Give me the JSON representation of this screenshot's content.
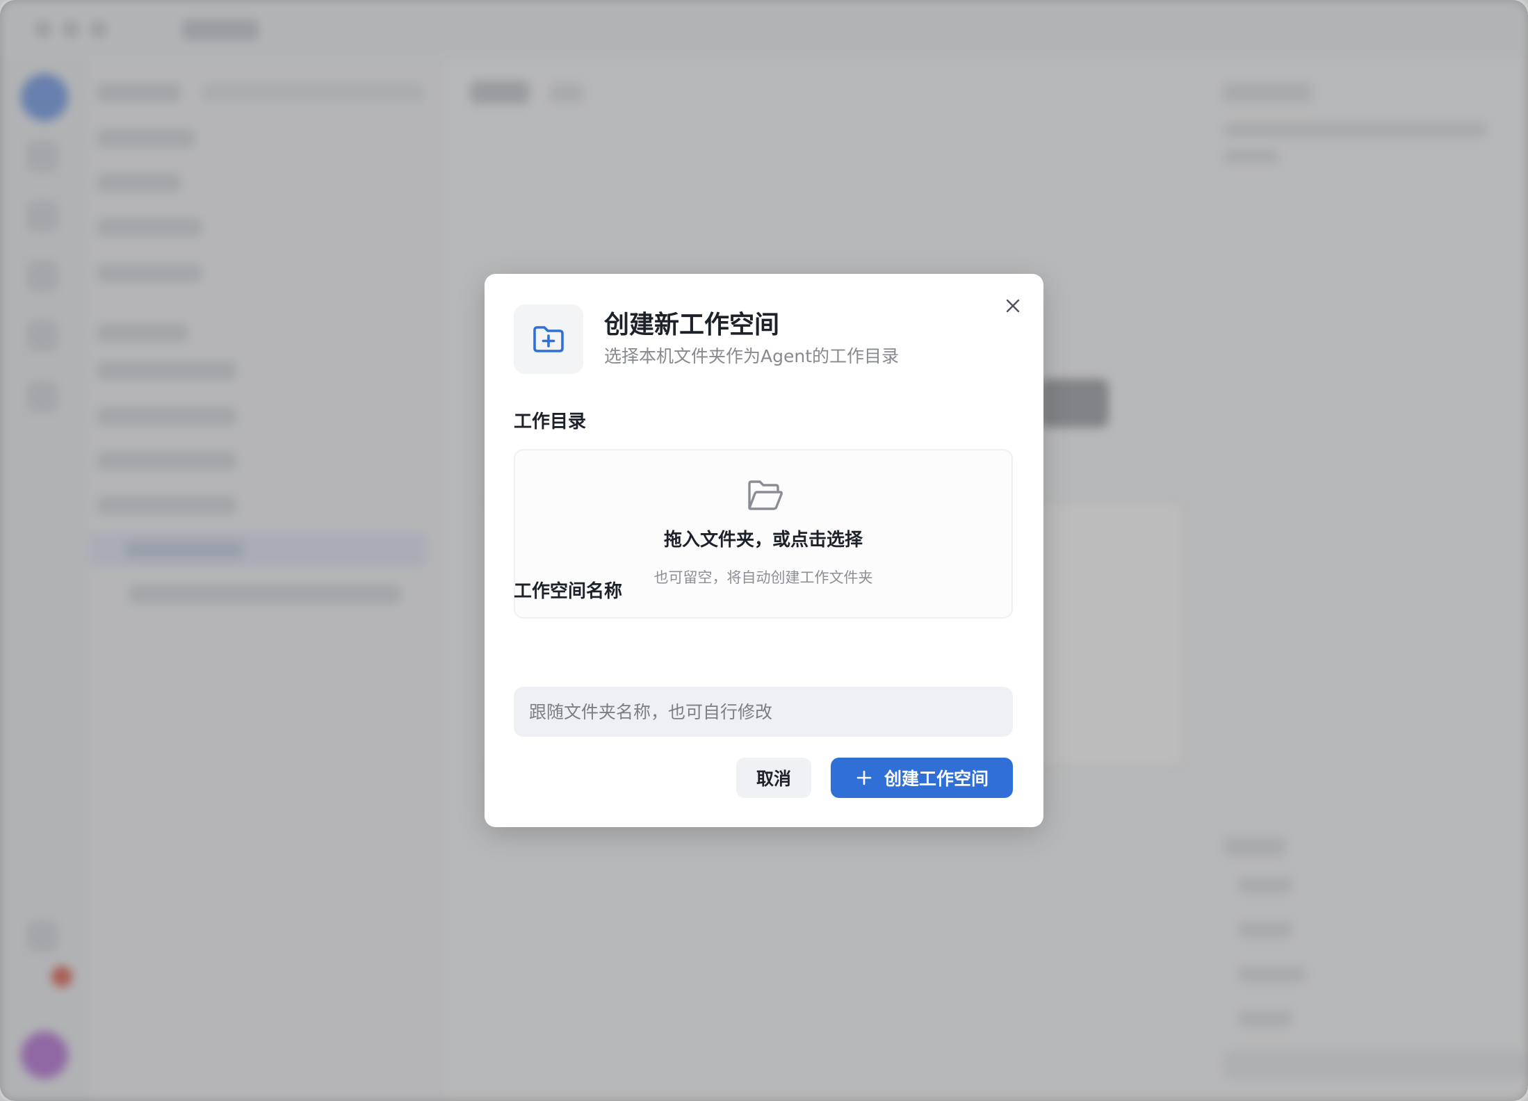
{
  "modal": {
    "title": "创建新工作空间",
    "subtitle": "选择本机文件夹作为Agent的工作目录",
    "close_icon": "close-icon",
    "header_icon": "folder-plus-icon",
    "directory": {
      "label": "工作目录",
      "dropzone_icon": "folder-open-icon",
      "dropzone_title": "拖入文件夹，或点击选择",
      "dropzone_hint": "也可留空，将自动创建工作文件夹"
    },
    "name": {
      "label": "工作空间名称",
      "value": "",
      "placeholder": "跟随文件夹名称，也可自行修改"
    },
    "actions": {
      "cancel_label": "取消",
      "create_label": "创建工作空间",
      "create_icon": "plus-icon"
    }
  },
  "colors": {
    "accent": "#2f6fd6",
    "title_text": "#1d2129",
    "muted_text": "#86898f",
    "input_bg": "#eff0f3"
  }
}
